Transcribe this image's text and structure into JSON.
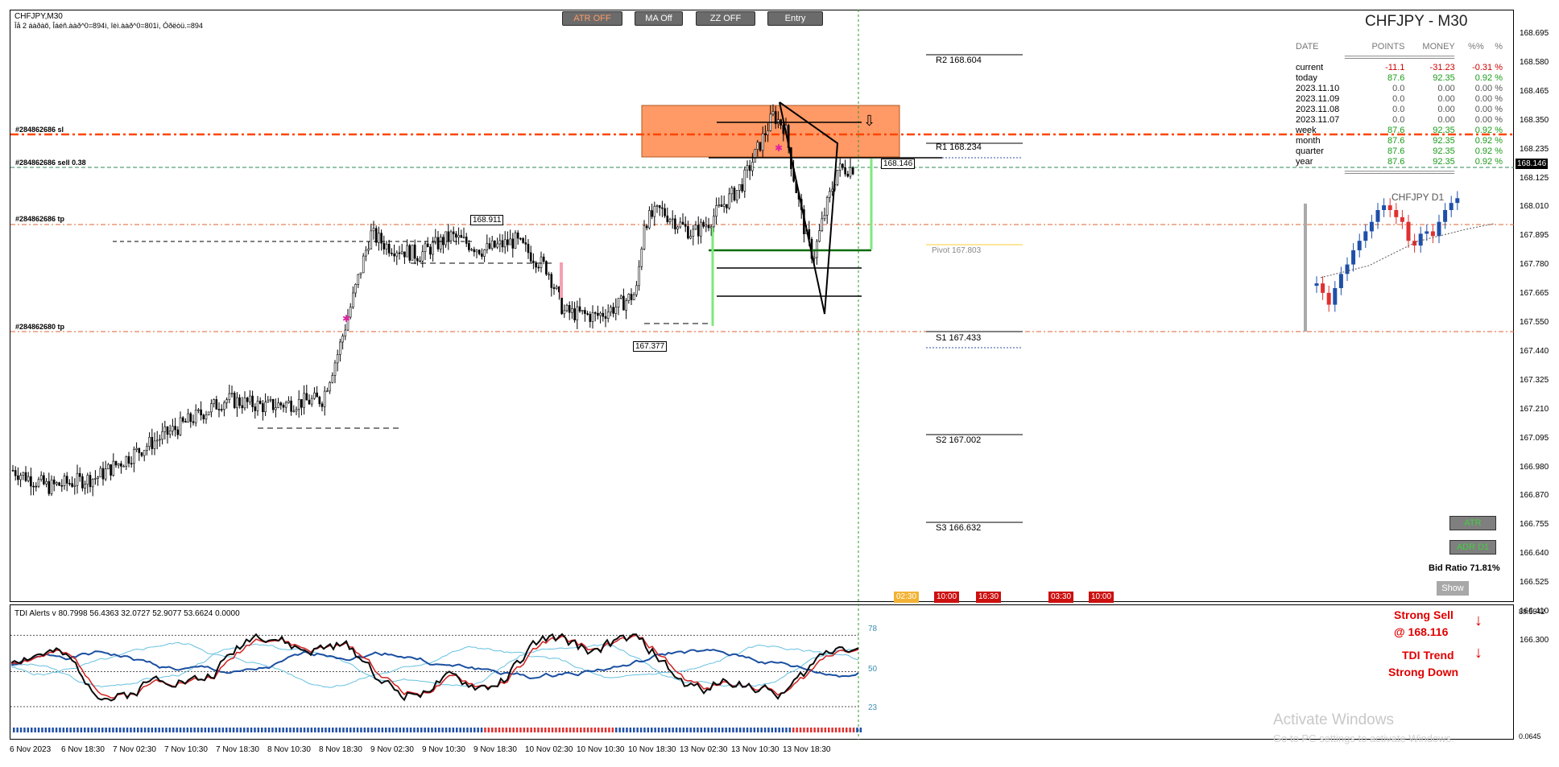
{
  "symbol_header": "CHFJPY,M30",
  "symbol_subheader": "Îå 2 áàðàõ, Îáéñ.ààð^0=894ì, îèì.ààð^0=801ì, Óðëòü.=894",
  "title": "CHFJPY - M30",
  "buttons": {
    "atr": "ATR OFF",
    "ma": "MA Off",
    "zz": "ZZ OFF",
    "entry": "Entry"
  },
  "orders": [
    {
      "label": "#284862686 sl",
      "price": 168.3
    },
    {
      "label": "#284862686 sell 0.38",
      "price": 168.126
    },
    {
      "label": "#284862686 tp",
      "price": 167.9
    },
    {
      "label": "#284862680 tp",
      "price": 167.44
    }
  ],
  "pivots": [
    {
      "label": "R2 168.604",
      "price": 168.604
    },
    {
      "label": "R1 168.234",
      "price": 168.234
    },
    {
      "label": "Pivot 167.803",
      "price": 167.803
    },
    {
      "label": "S1 167.433",
      "price": 167.433
    },
    {
      "label": "S2 167.002",
      "price": 167.002
    },
    {
      "label": "S3 166.632",
      "price": 166.632
    }
  ],
  "price_labels": [
    "168.911",
    "167.377",
    "168.146"
  ],
  "price_axis": [
    "168.695",
    "168.580",
    "168.465",
    "168.350",
    "168.235",
    "168.125",
    "168.010",
    "167.895",
    "167.780",
    "167.665",
    "167.550",
    "167.440",
    "167.325",
    "167.210",
    "167.095",
    "166.980",
    "166.870",
    "166.755",
    "166.640",
    "166.525",
    "166.410",
    "166.300"
  ],
  "current_price": "168.146",
  "indicator_axis_top": "89.5542",
  "indicator_axis_bottom": "0.0645",
  "time_axis": [
    "6 Nov 2023",
    "6 Nov 18:30",
    "7 Nov 02:30",
    "7 Nov 10:30",
    "7 Nov 18:30",
    "8 Nov 10:30",
    "8 Nov 18:30",
    "9 Nov 02:30",
    "9 Nov 10:30",
    "9 Nov 18:30",
    "10 Nov 02:30",
    "10 Nov 10:30",
    "10 Nov 18:30",
    "13 Nov 02:30",
    "13 Nov 10:30",
    "13 Nov 18:30"
  ],
  "stats": {
    "headers": [
      "DATE",
      "POINTS",
      "MONEY",
      "%%",
      "%"
    ],
    "separator": "================================",
    "rows": [
      {
        "date": "current",
        "points": "-11.1",
        "money": "-31.23",
        "pct": "-0.31",
        "unit": "%",
        "tone": "neg"
      },
      {
        "date": "today",
        "points": "87.6",
        "money": "92.35",
        "pct": "0.92",
        "unit": "%",
        "tone": "pos"
      },
      {
        "date": "2023.11.10",
        "points": "0.0",
        "money": "0.00",
        "pct": "0.00",
        "unit": "%",
        "tone": "neu"
      },
      {
        "date": "2023.11.09",
        "points": "0.0",
        "money": "0.00",
        "pct": "0.00",
        "unit": "%",
        "tone": "neu"
      },
      {
        "date": "2023.11.08",
        "points": "0.0",
        "money": "0.00",
        "pct": "0.00",
        "unit": "%",
        "tone": "neu"
      },
      {
        "date": "2023.11.07",
        "points": "0.0",
        "money": "0.00",
        "pct": "0.00",
        "unit": "%",
        "tone": "neu"
      },
      {
        "date": "week",
        "points": "87.6",
        "money": "92.35",
        "pct": "0.92",
        "unit": "%",
        "tone": "pos"
      },
      {
        "date": "month",
        "points": "87.6",
        "money": "92.35",
        "pct": "0.92",
        "unit": "%",
        "tone": "pos"
      },
      {
        "date": "quarter",
        "points": "87.6",
        "money": "92.35",
        "pct": "0.92",
        "unit": "%",
        "tone": "pos"
      },
      {
        "date": "year",
        "points": "87.6",
        "money": "92.35",
        "pct": "0.92",
        "unit": "%",
        "tone": "pos"
      }
    ]
  },
  "d1_title": "CHFJPY  D1",
  "side_buttons": {
    "atr": "ATR",
    "adr": "ADR D1"
  },
  "bid_ratio": "Bid Ratio 71.81%",
  "show_button": "Show",
  "session_tags": [
    "02:30",
    "10:00",
    "16:30",
    "03:30",
    "10:00"
  ],
  "tdi": {
    "label": "TDI Alerts v 80.7998 56.4363 32.0727 52.9077 53.6624 0.0000",
    "levels": [
      "78",
      "50",
      "23"
    ]
  },
  "signals": {
    "line1": "Strong Sell",
    "line2": "@ 168.116",
    "line3": "TDI Trend",
    "line4": "Strong Down",
    "arrow": "↓"
  },
  "watermark": {
    "line1": "Activate Windows",
    "line2": "Go to PC settings to activate Windows."
  },
  "colors": {
    "supply_zone": "#ff9966",
    "sl_line": "#ff4500",
    "sell_line": "#2e8b57",
    "tp_line": "#e06030",
    "pivot_line": "#ffcc33",
    "bull": "#1f4fa8",
    "bear": "#e03030",
    "tdi_green": "#0a0a0a",
    "tdi_red": "#d02020",
    "tdi_blue": "#1a4fa0",
    "tdi_band": "#66c0e0"
  }
}
